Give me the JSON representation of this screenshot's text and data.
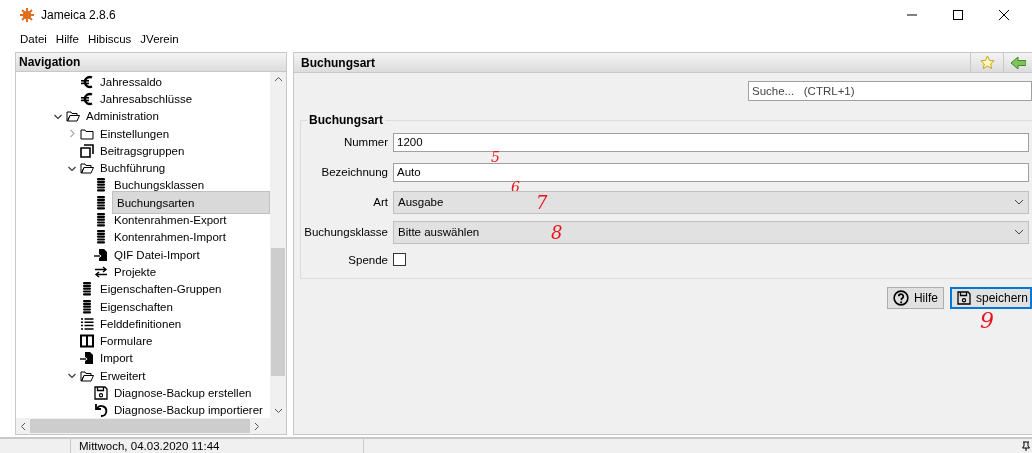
{
  "window": {
    "title": "Jameica 2.8.6"
  },
  "menu": [
    "Datei",
    "Hilfe",
    "Hibiscus",
    "JVerein"
  ],
  "navigation": {
    "title": "Navigation",
    "tree": [
      {
        "children": [
          {
            "label": "Jahressaldo",
            "kind": "euro",
            "selected": false
          },
          {
            "label": "Jahresabschlüsse",
            "kind": "euro",
            "selected": false
          }
        ]
      },
      {
        "label": "Administration",
        "kind": "folder-open",
        "expanded": true,
        "selected": false,
        "children": [
          {
            "label": "Einstellungen",
            "kind": "folder",
            "expanded": false,
            "selected": false
          },
          {
            "label": "Beitragsgruppen",
            "kind": "pages",
            "selected": false
          },
          {
            "label": "Buchführung",
            "kind": "folder-open",
            "expanded": true,
            "selected": false,
            "children": [
              {
                "label": "Buchungsklassen",
                "kind": "rows",
                "selected": false
              },
              {
                "label": "Buchungsarten",
                "kind": "rows",
                "selected": true
              },
              {
                "label": "Kontenrahmen-Export",
                "kind": "rows",
                "selected": false
              },
              {
                "label": "Kontenrahmen-Import",
                "kind": "rows",
                "selected": false
              },
              {
                "label": "QIF Datei-Import",
                "kind": "import",
                "selected": false
              },
              {
                "label": "Projekte",
                "kind": "arrows",
                "selected": false
              }
            ]
          },
          {
            "label": "Eigenschaften-Gruppen",
            "kind": "rows",
            "selected": false
          },
          {
            "label": "Eigenschaften",
            "kind": "rows",
            "selected": false
          },
          {
            "label": "Felddefinitionen",
            "kind": "list",
            "selected": false
          },
          {
            "label": "Formulare",
            "kind": "columns",
            "selected": false
          },
          {
            "label": "Import",
            "kind": "import",
            "selected": false
          },
          {
            "label": "Erweitert",
            "kind": "folder-open",
            "expanded": true,
            "selected": false,
            "children": [
              {
                "label": "Diagnose-Backup erstellen",
                "kind": "save",
                "selected": false
              },
              {
                "label": "Diagnose-Backup importierer",
                "kind": "restore",
                "selected": false
              }
            ]
          }
        ]
      }
    ]
  },
  "content": {
    "title": "Buchungsart",
    "search": {
      "placeholder": "Suche...   (CTRL+1)"
    },
    "group": {
      "title": "Buchungsart",
      "fields": [
        {
          "label": "Nummer",
          "kind": "text",
          "value": "1200",
          "annotation": "5"
        },
        {
          "label": "Bezeichnung",
          "kind": "text",
          "value": "Auto",
          "annotation": "6"
        },
        {
          "label": "Art",
          "kind": "select",
          "value": "Ausgabe",
          "annotation": "7"
        },
        {
          "label": "Buchungsklasse",
          "kind": "select",
          "value": "Bitte auswählen",
          "annotation": "8"
        },
        {
          "label": "Spende",
          "kind": "checkbox",
          "checked": false
        }
      ]
    },
    "buttons": [
      {
        "label": "Hilfe",
        "kind": "help",
        "focused": false
      },
      {
        "label": "speichern",
        "kind": "save",
        "focused": true,
        "annotation": "9"
      }
    ]
  },
  "status_bar": {
    "datetime": "Mittwoch, 04.03.2020 11:44"
  }
}
